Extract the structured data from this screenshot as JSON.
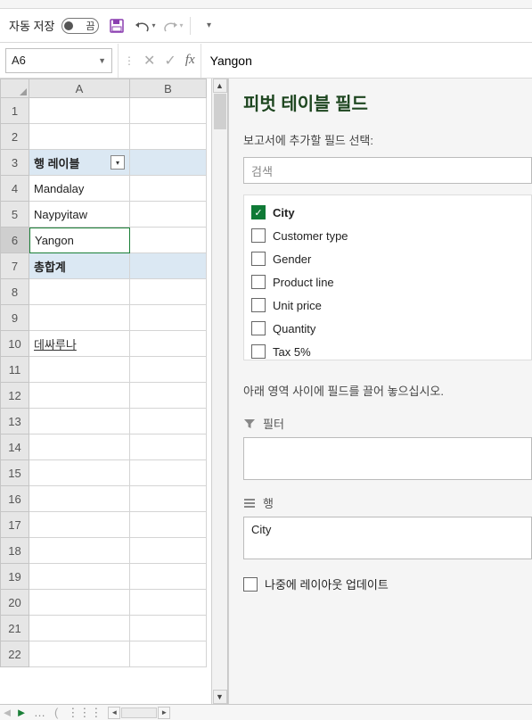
{
  "qat": {
    "autosave_label": "자동 저장",
    "autosave_toggle_off": "끔"
  },
  "namebox": {
    "ref": "A6"
  },
  "formula": {
    "value": "Yangon"
  },
  "grid": {
    "cols": [
      "A",
      "B"
    ],
    "rows": [
      {
        "n": "1",
        "a": "",
        "b": ""
      },
      {
        "n": "2",
        "a": "",
        "b": ""
      },
      {
        "n": "3",
        "a": "행 레이블",
        "b": "",
        "bold": true,
        "hl": true,
        "filter": true
      },
      {
        "n": "4",
        "a": "Mandalay",
        "b": ""
      },
      {
        "n": "5",
        "a": "Naypyitaw",
        "b": ""
      },
      {
        "n": "6",
        "a": "Yangon",
        "b": "",
        "active": true
      },
      {
        "n": "7",
        "a": "총합계",
        "b": "",
        "bold": true,
        "hl": true
      },
      {
        "n": "8",
        "a": "",
        "b": ""
      },
      {
        "n": "9",
        "a": "",
        "b": ""
      },
      {
        "n": "10",
        "a": "데싸루나",
        "b": "",
        "link": true
      },
      {
        "n": "11",
        "a": "",
        "b": ""
      },
      {
        "n": "12",
        "a": "",
        "b": ""
      },
      {
        "n": "13",
        "a": "",
        "b": ""
      },
      {
        "n": "14",
        "a": "",
        "b": ""
      },
      {
        "n": "15",
        "a": "",
        "b": ""
      },
      {
        "n": "16",
        "a": "",
        "b": ""
      },
      {
        "n": "17",
        "a": "",
        "b": ""
      },
      {
        "n": "18",
        "a": "",
        "b": ""
      },
      {
        "n": "19",
        "a": "",
        "b": ""
      },
      {
        "n": "20",
        "a": "",
        "b": ""
      },
      {
        "n": "21",
        "a": "",
        "b": ""
      },
      {
        "n": "22",
        "a": "",
        "b": ""
      }
    ]
  },
  "pane": {
    "title": "피벗 테이블 필드",
    "subtitle": "보고서에 추가할 필드 선택:",
    "search_placeholder": "검색",
    "fields": [
      {
        "name": "City",
        "checked": true,
        "bold": true
      },
      {
        "name": "Customer type",
        "checked": false
      },
      {
        "name": "Gender",
        "checked": false
      },
      {
        "name": "Product line",
        "checked": false
      },
      {
        "name": "Unit price",
        "checked": false
      },
      {
        "name": "Quantity",
        "checked": false
      },
      {
        "name": "Tax 5%",
        "checked": false
      }
    ],
    "instruction": "아래 영역 사이에 필드를 끌어 놓으십시오.",
    "area_filter_label": "필터",
    "area_rows_label": "행",
    "rows_items": [
      "City"
    ],
    "defer_label": "나중에 레이아웃 업데이트"
  }
}
